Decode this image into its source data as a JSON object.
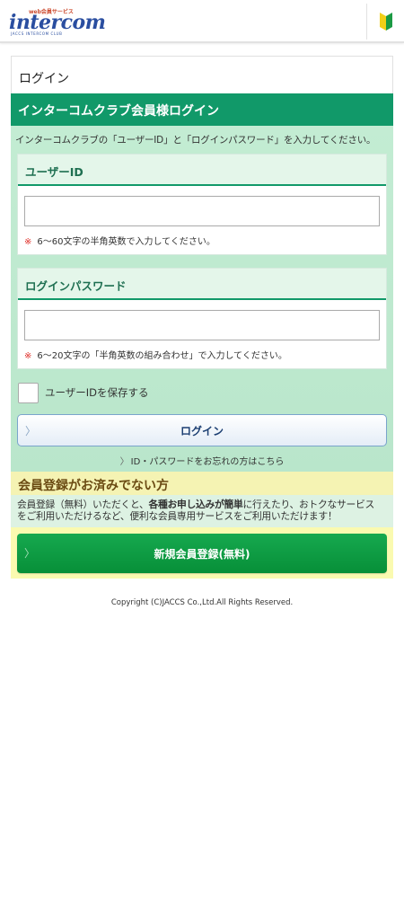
{
  "header": {
    "logo": {
      "tagline": "web会員サービス",
      "main": "intercom",
      "sub": "JACCS INTERCOM CLUB"
    },
    "beginner_icon": "beginner-mark-icon"
  },
  "login": {
    "page_title": "ログイン",
    "section_title": "インターコムクラブ会員様ログイン",
    "intro": "インターコムクラブの「ユーザーID」と「ログインパスワード」を入力してください。",
    "user_id": {
      "label": "ユーザーID",
      "value": "",
      "hint_mark": "※",
      "hint": "6〜60文字の半角英数で入力してください。"
    },
    "password": {
      "label": "ログインパスワード",
      "value": "",
      "hint_mark": "※",
      "hint": "6〜20文字の「半角英数の組み合わせ」で入力してください。"
    },
    "save_id_label": "ユーザーIDを保存する",
    "login_button": "ログイン",
    "forgot_link": "ID・パスワードをお忘れの方はこちら",
    "chevron": "〉"
  },
  "register": {
    "title": "会員登録がお済みでない方",
    "desc_1a": "会員登録（無料）いただくと、",
    "desc_1b": "各種お申し込みが簡単",
    "desc_1c": "に行えたり、おトクなサービス",
    "desc_2": "をご利用いただけるなど、便利な会員専用サービスをご利用いただけます！",
    "button": "新規会員登録(無料)"
  },
  "footer": {
    "copyright": "Copyright (C)JACCS Co.,Ltd.All Rights Reserved."
  },
  "colors": {
    "brand_green": "#119969",
    "register_button": "#0a9a40",
    "logo_blue": "#2a4ea0",
    "notice_yellow": "#f5f3b3"
  }
}
